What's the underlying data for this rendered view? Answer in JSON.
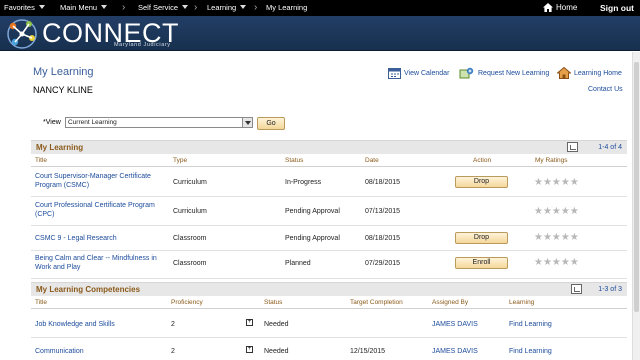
{
  "nav": {
    "favorites": "Favorites",
    "main_menu": "Main Menu",
    "breadcrumb": [
      "Self Service",
      "Learning",
      "My Learning"
    ],
    "home": "Home",
    "sign_out": "Sign out"
  },
  "brand": {
    "title": "CONNECT",
    "subtitle": "Maryland Judiciary"
  },
  "page": {
    "title": "My Learning",
    "user": "NANCY KLINE",
    "links": {
      "view_calendar": "View Calendar",
      "request_learning": "Request New Learning",
      "learning_home": "Learning Home",
      "contact_us": "Contact Us"
    }
  },
  "view": {
    "label": "*View",
    "value": "Current Learning",
    "go": "Go"
  },
  "my_learning": {
    "title": "My Learning",
    "count": "1-4 of 4",
    "columns": [
      "Title",
      "Type",
      "Status",
      "Date",
      "Action",
      "My Ratings"
    ],
    "rows": [
      {
        "title1": "Court Supervisor-Manager Certificate",
        "title2": "Program (CSMC)",
        "type": "Curriculum",
        "status": "In-Progress",
        "date": "08/18/2015",
        "action": "Drop",
        "rating": "★★★★★"
      },
      {
        "title1": "Court Professional Certificate Program",
        "title2": "(CPC)",
        "type": "Curriculum",
        "status": "Pending Approval",
        "date": "07/13/2015",
        "action": "",
        "rating": "★★★★★"
      },
      {
        "title1": "CSMC 9 - Legal Research",
        "title2": "",
        "type": "Classroom",
        "status": "Pending Approval",
        "date": "08/18/2015",
        "action": "Drop",
        "rating": "★★★★★"
      },
      {
        "title1": "Being Calm and Clear -- Mindfulness in",
        "title2": "Work and Play",
        "type": "Classroom",
        "status": "Planned",
        "date": "07/29/2015",
        "action": "Enroll",
        "rating": "★★★★★"
      }
    ]
  },
  "competencies": {
    "title": "My Learning Competencies",
    "count": "1-3 of 3",
    "columns": [
      "Title",
      "Proficiency",
      "Status",
      "Target Completion",
      "Assigned By",
      "Learning"
    ],
    "rows": [
      {
        "title": "Job Knowledge and Skills",
        "proficiency": "2",
        "status": "Needed",
        "target": "",
        "assigned_by": "JAMES DAVIS",
        "learning": "Find Learning"
      },
      {
        "title": "Communication",
        "proficiency": "2",
        "status": "Needed",
        "target": "12/15/2015",
        "assigned_by": "JAMES DAVIS",
        "learning": "Find Learning"
      }
    ]
  }
}
